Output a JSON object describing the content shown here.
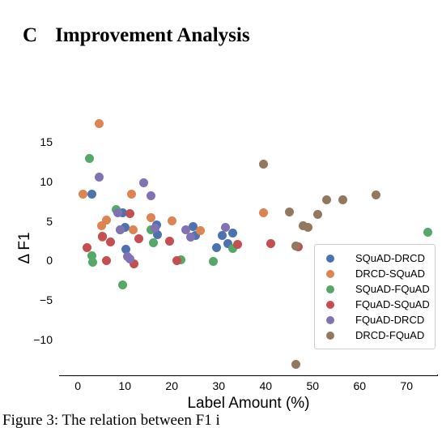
{
  "heading": {
    "section_label": "C",
    "title": "Improvement Analysis"
  },
  "caption": {
    "text": "Figure 3: The relation between F1 i"
  },
  "colors": {
    "blue": "#4c72b0",
    "orange": "#dd8452",
    "green": "#55a868",
    "red": "#c44e52",
    "purple": "#8172b3",
    "brown": "#937860",
    "axis": "#000000",
    "legend_border": "#cccccc",
    "background": "#ffffff"
  },
  "chart_data": {
    "type": "scatter",
    "title": "",
    "xlabel": "Label Amount (%)",
    "ylabel": "Δ F1",
    "xlim": [
      -4.0,
      76.5
    ],
    "ylim": [
      -14.5,
      18.8
    ],
    "xticks": [
      0,
      10,
      20,
      30,
      40,
      50,
      60,
      70
    ],
    "xticklabels": [
      "0",
      "10",
      "20",
      "30",
      "40",
      "50",
      "60",
      "70"
    ],
    "yticks": [
      15,
      10,
      5,
      0,
      -5,
      -10
    ],
    "yticklabels": [
      "15",
      "10",
      "5",
      "0",
      "−5",
      "−10"
    ],
    "grid": false,
    "legend_position": "lower right",
    "marker_size": 11,
    "series": [
      {
        "name": "SQuAD-DRCD",
        "color": "#4c72b0",
        "points": [
          [
            3.0,
            8.4
          ],
          [
            9.5,
            6.0
          ],
          [
            10.0,
            4.2
          ],
          [
            10.3,
            1.4
          ],
          [
            16.8,
            4.5
          ],
          [
            17.0,
            3.3
          ],
          [
            24.5,
            4.3
          ],
          [
            25.0,
            3.2
          ],
          [
            29.5,
            1.6
          ],
          [
            30.8,
            3.2
          ],
          [
            32.0,
            2.2
          ],
          [
            33.0,
            3.5
          ]
        ]
      },
      {
        "name": "DRCD-SQuAD",
        "color": "#dd8452",
        "points": [
          [
            1.0,
            8.4
          ],
          [
            4.5,
            17.3
          ],
          [
            5.0,
            4.4
          ],
          [
            5.2,
            3.0
          ],
          [
            6.0,
            5.1
          ],
          [
            11.5,
            8.4
          ],
          [
            11.8,
            3.9
          ],
          [
            15.5,
            5.4
          ],
          [
            20.0,
            5.0
          ],
          [
            26.0,
            3.8
          ],
          [
            39.5,
            6.0
          ]
        ]
      },
      {
        "name": "SQuAD-FQuAD",
        "color": "#55a868",
        "points": [
          [
            2.5,
            12.9
          ],
          [
            3.0,
            0.6
          ],
          [
            3.2,
            -0.2
          ],
          [
            8.2,
            6.5
          ],
          [
            9.0,
            3.9
          ],
          [
            9.5,
            -3.1
          ],
          [
            15.5,
            3.9
          ],
          [
            16.0,
            2.3
          ],
          [
            22.0,
            0.1
          ],
          [
            28.8,
            -0.1
          ],
          [
            33.0,
            1.5
          ],
          [
            74.5,
            3.6
          ]
        ]
      },
      {
        "name": "FQuAD-SQuAD",
        "color": "#c44e52",
        "points": [
          [
            2.0,
            1.6
          ],
          [
            5.2,
            3.1
          ],
          [
            6.0,
            0.0
          ],
          [
            7.0,
            2.4
          ],
          [
            11.0,
            5.9
          ],
          [
            12.0,
            -0.4
          ],
          [
            13.0,
            2.8
          ],
          [
            19.5,
            2.5
          ],
          [
            21.0,
            0.0
          ],
          [
            34.0,
            2.0
          ],
          [
            41.0,
            2.2
          ],
          [
            47.0,
            1.7
          ]
        ]
      },
      {
        "name": "FQuAD-DRCD",
        "color": "#8172b3",
        "points": [
          [
            4.5,
            10.6
          ],
          [
            8.5,
            6.0
          ],
          [
            9.0,
            3.9
          ],
          [
            10.5,
            0.5
          ],
          [
            11.0,
            0.2
          ],
          [
            14.0,
            9.8
          ],
          [
            15.5,
            8.2
          ],
          [
            16.5,
            4.1
          ],
          [
            23.0,
            3.9
          ],
          [
            24.0,
            3.0
          ],
          [
            31.5,
            4.2
          ]
        ]
      },
      {
        "name": "DRCD-FQuAD",
        "color": "#937860",
        "points": [
          [
            39.5,
            12.2
          ],
          [
            45.0,
            6.1
          ],
          [
            46.5,
            1.8
          ],
          [
            48.0,
            4.4
          ],
          [
            49.0,
            4.2
          ],
          [
            51.0,
            5.8
          ],
          [
            53.0,
            7.7
          ],
          [
            56.5,
            7.7
          ],
          [
            63.5,
            8.3
          ],
          [
            46.5,
            -13.1
          ]
        ]
      }
    ]
  },
  "legend": {
    "items": [
      {
        "label": "SQuAD-DRCD",
        "color": "#4c72b0"
      },
      {
        "label": "DRCD-SQuAD",
        "color": "#dd8452"
      },
      {
        "label": "SQuAD-FQuAD",
        "color": "#55a868"
      },
      {
        "label": "FQuAD-SQuAD",
        "color": "#c44e52"
      },
      {
        "label": "FQuAD-DRCD",
        "color": "#8172b3"
      },
      {
        "label": "DRCD-FQuAD",
        "color": "#937860"
      }
    ]
  }
}
